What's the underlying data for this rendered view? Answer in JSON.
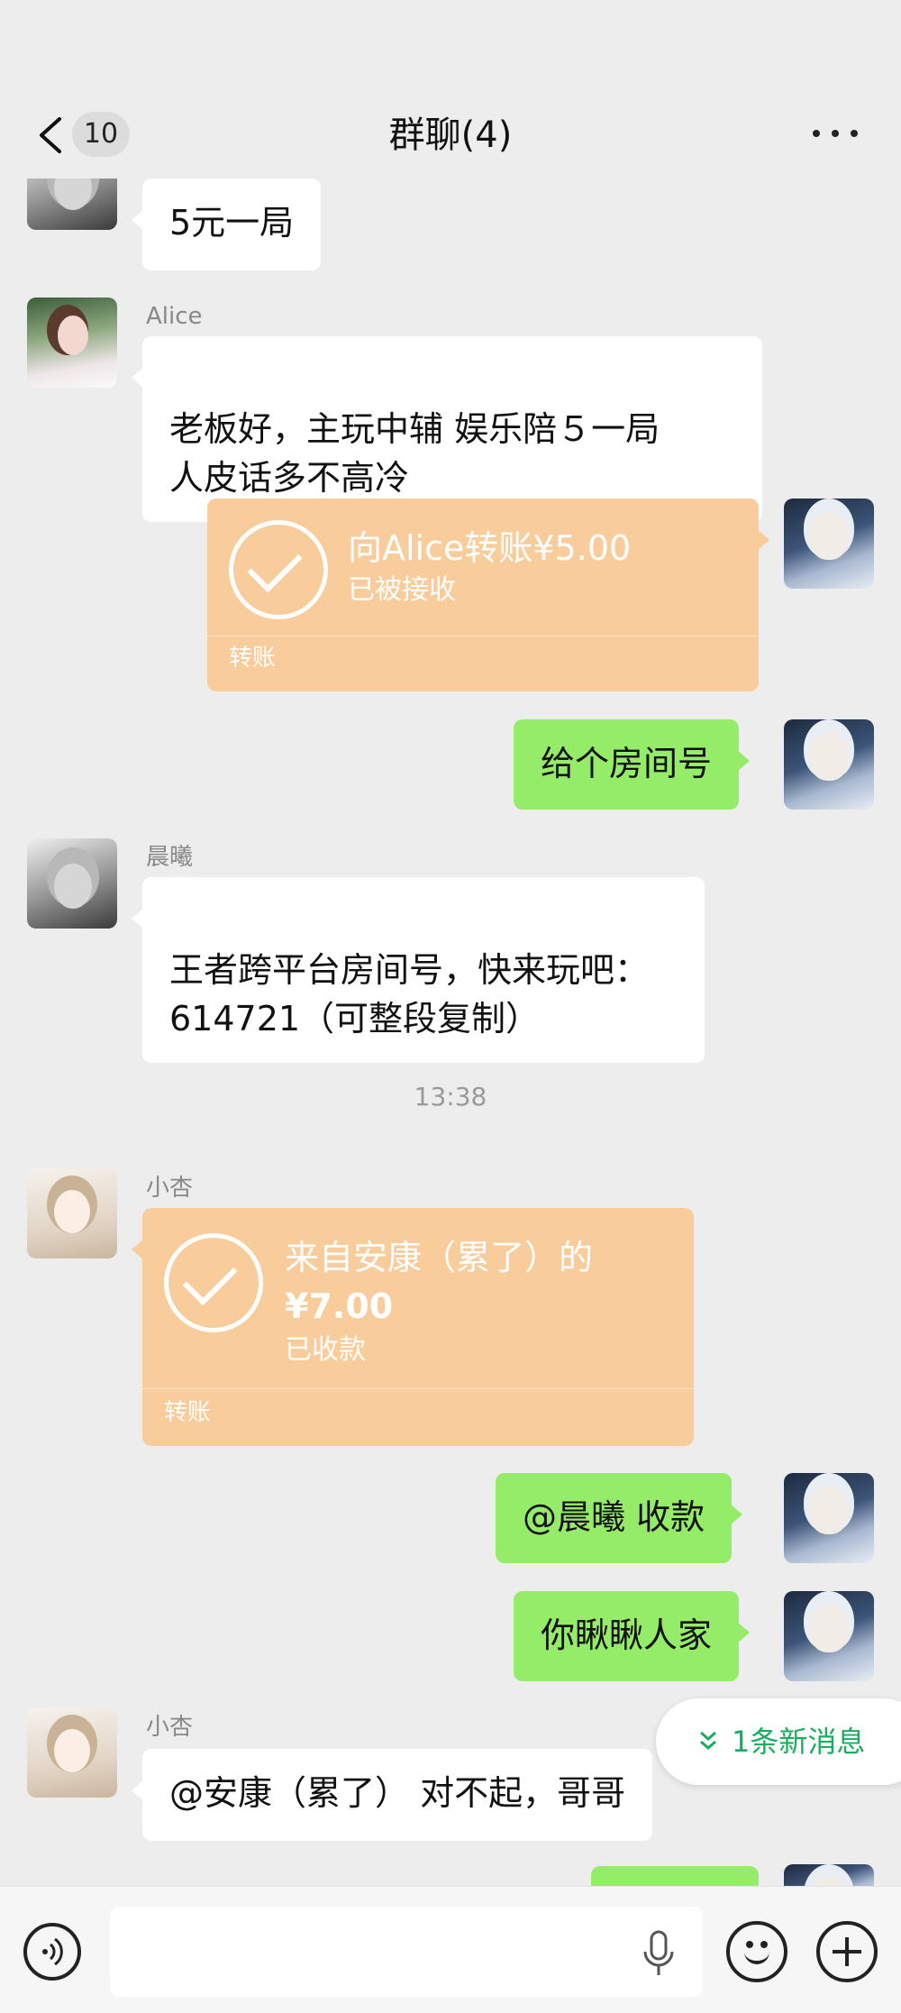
{
  "header": {
    "unread_count": "10",
    "title": "群聊(4)"
  },
  "messages": [
    {
      "id": "m1",
      "side": "left",
      "sender": "",
      "text": "5元一局"
    },
    {
      "id": "m2",
      "side": "left",
      "sender": "Alice",
      "text": "老板好，主玩中辅 娱乐陪５一局\n人皮话多不高冷"
    },
    {
      "id": "m3",
      "side": "right",
      "type": "transfer",
      "title": "向Alice转账¥5.00",
      "status": "已被接收",
      "label": "转账"
    },
    {
      "id": "m4",
      "side": "right",
      "text": "给个房间号"
    },
    {
      "id": "m5",
      "side": "left",
      "sender": "晨曦",
      "text": "王者跨平台房间号，快来玩吧：\n614721（可整段复制）"
    },
    {
      "id": "m6",
      "side": "left",
      "sender": "小杏",
      "type": "transfer",
      "title_line1": "来自安康（累了）的",
      "title_line2": "¥7.00",
      "status": "已收款",
      "label": "转账"
    },
    {
      "id": "m7",
      "side": "right",
      "text": "@晨曦  收款"
    },
    {
      "id": "m8",
      "side": "right",
      "text": "你瞅瞅人家"
    },
    {
      "id": "m9",
      "side": "left",
      "sender": "小杏",
      "text": "@安康（累了） 对不起，哥哥"
    }
  ],
  "timestamp": "13:38",
  "new_message_pill": "1条新消息",
  "colors": {
    "background": "#ededed",
    "green_bubble": "#95ec69",
    "transfer_card": "#f9cc9b",
    "new_message_text": "#1aad5f"
  }
}
